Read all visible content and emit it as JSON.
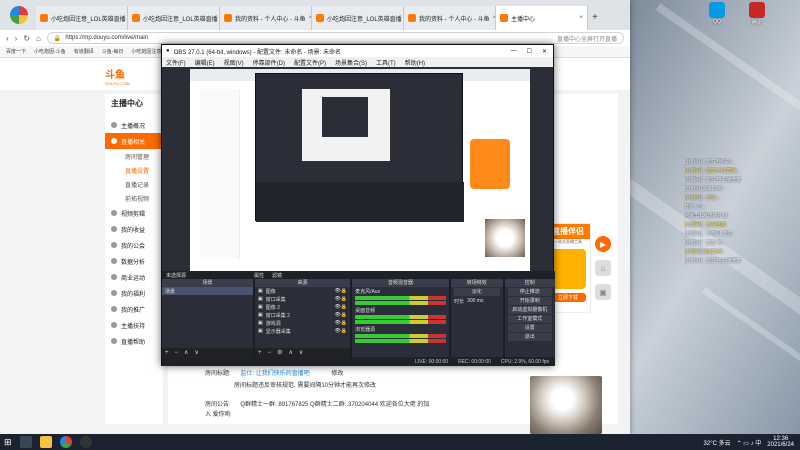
{
  "browser": {
    "tabs": [
      {
        "title": "小吃炮因注意_LOL英雄直播"
      },
      {
        "title": "小吃炮因注意_LOL英雄直播"
      },
      {
        "title": "我的资料 - 个人中心 - 斗鱼"
      },
      {
        "title": "小吃炮因注意_LOL英雄直播"
      },
      {
        "title": "我的资料 - 个人中心 - 斗鱼"
      },
      {
        "title": "主播中心"
      }
    ],
    "url": "https://mp.douyu.com/live/main",
    "search_hint": "直播中心全屏打开直播",
    "bookmarks": [
      "百度一下",
      "小吃炮因-斗鱼",
      "有道翻译",
      "斗鱼-每日",
      "小吃炮因注意...",
      "Bili...",
      "网址"
    ]
  },
  "site": {
    "brand": "斗鱼",
    "brand_sub": "DOUYU.COM",
    "sidebar_title": "主播中心",
    "items": [
      {
        "label": "主播概况",
        "active": false
      },
      {
        "label": "直播相关",
        "active": true
      }
    ],
    "subitems": [
      {
        "label": "房间管理",
        "active": false
      },
      {
        "label": "直播设置",
        "active": true
      },
      {
        "label": "直播记录",
        "active": false
      },
      {
        "label": "前拓视频",
        "active": false
      }
    ],
    "items2": [
      "视频剪辑",
      "我的收益",
      "我的公会",
      "数据分析",
      "商业运动",
      "我的福利",
      "我的推广",
      "主播扶持",
      "直播帮助"
    ],
    "room_title_label": "房间标题:",
    "room_title": "监仕: 让我们快乐的直播吧",
    "modify": "修改",
    "warning": "房间标题违反审核规范, 需要间隔10分钟才能再次修改",
    "notice_label": "房间公告:",
    "notice": "Q群精士一群: 891767825  Q群精士二群: 370204044  欢迎各位大佬 的加入 爱你哟",
    "promo_title": "直播伴侣",
    "promo_sub": "一站式直播工具",
    "promo_btn": "立即下载"
  },
  "obs": {
    "title": "OBS 27.0.1 (64-bit, windows) - 配置文件: 未命名 - 场景: 未命名",
    "menu": [
      "文件(F)",
      "编辑(E)",
      "视图(V)",
      "停靠部件(D)",
      "配置文件(P)",
      "场景集合(S)",
      "工具(T)",
      "帮助(H)"
    ],
    "no_source": "未选择源",
    "props": "属性",
    "filters": "滤镜",
    "docks": {
      "scenes": "场景",
      "sources": "来源",
      "mixer": "音频混音器",
      "transitions": "转场特效",
      "controls": "控制"
    },
    "scene_items": [
      "场景"
    ],
    "source_items": [
      "图像",
      "窗口采集",
      "图像 2",
      "窗口采集 2",
      "游戏源",
      "显示器采集"
    ],
    "mixer_items": [
      "麦克风/Aux",
      "桌面音频",
      "浏览器源"
    ],
    "transition": "淡化",
    "duration_label": "时长",
    "duration": "300 ms",
    "controls": [
      "停止推流",
      "开始录制",
      "启动虚拟摄像机",
      "工作室模式",
      "设置",
      "退出"
    ],
    "status": [
      "LIVE: 00:00:00",
      "REC: 00:00:00",
      "CPU: 2.9%, 60.00 fps"
    ]
  },
  "chat": [
    "[小炮闪] : 正在与你的...",
    "[小炮闪] : 正在与你直播...",
    "[小炮闪] : 正在与主播连麦",
    "[小炮闪] 2066343",
    "[小炮闪] : 正在...",
    "灯花: 在...",
    "阿瓦里100送的礼物",
    "[小炮闪] : 正在连麦",
    "[小炮闪] : 小炮闪 正在",
    "[小炮闪] : 正在 与...",
    "[小炮闪] 2066343",
    "[小炮闪] : 正在与主播连麦"
  ],
  "taskbar": {
    "weather": "32°C 多云",
    "time": "12:36",
    "date": "2021/6/24"
  },
  "desktop_icons": [
    "网易",
    "我的",
    "小吃",
    "游戏",
    "有道",
    "斗鱼",
    "主播",
    "哔哩",
    "OBS",
    "360",
    "AI",
    "Lol",
    "QQ",
    "腾讯"
  ]
}
